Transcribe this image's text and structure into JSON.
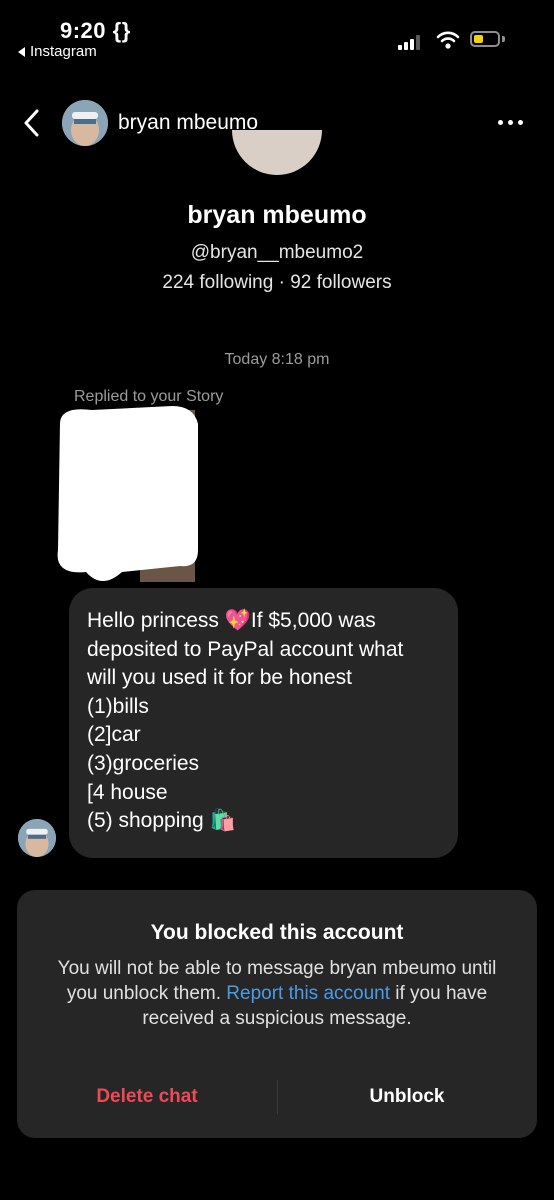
{
  "status_bar": {
    "time": "9:20 {}",
    "back_app": "Instagram",
    "battery_color": "#f5d20a"
  },
  "header": {
    "contact_name": "bryan mbeumo",
    "back_icon": "chevron-left-icon",
    "more_icon": "more-horizontal-icon"
  },
  "profile": {
    "name": "bryan mbeumo",
    "username": "@bryan__mbeumo2",
    "stats": "224 following · 92 followers"
  },
  "thread": {
    "timestamp": "Today 8:18 pm",
    "replied_label": "Replied to your Story",
    "message_lines": [
      "Hello princess 💖If $5,000 was",
      "deposited to PayPal account what",
      "will you used it for be honest",
      "(1)bills",
      "(2]car",
      "(3)groceries",
      "[4 house",
      "(5) shopping 🛍️"
    ]
  },
  "block_card": {
    "title": "You blocked this account",
    "body_before": "You will not be able to message bryan mbeumo until you unblock them. ",
    "link_text": "Report this account",
    "body_after": " if you have received a suspicious message.",
    "delete_label": "Delete chat",
    "unblock_label": "Unblock",
    "link_color": "#4a9ce8",
    "delete_color": "#ed4956"
  }
}
